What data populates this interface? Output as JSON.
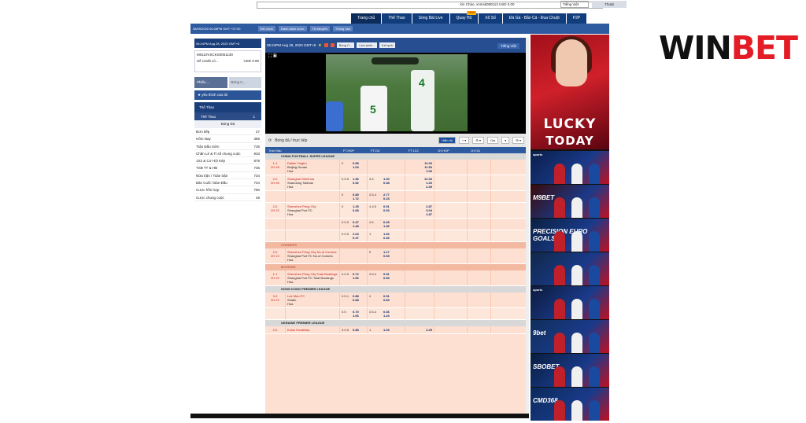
{
  "header": {
    "greeting": "Xin Chào, vnmsk080113 USD 0.00",
    "language": "Tiếng Việt",
    "logout": "Thoát"
  },
  "nav": {
    "tabs": [
      {
        "label": "Trang chủ",
        "badge": ""
      },
      {
        "label": "Thể Thao",
        "badge": ""
      },
      {
        "label": "Sòng Bài Live",
        "badge": ""
      },
      {
        "label": "Quay Hũ",
        "badge": "NEW"
      },
      {
        "label": "Xổ Số",
        "badge": ""
      },
      {
        "label": "Đá Gà - Bắn Cá - Đua Chuột",
        "badge": ""
      },
      {
        "label": "P2P",
        "badge": ""
      }
    ]
  },
  "subnav": {
    "datetime": "08/09/2020 06:28PM GMT +07:00",
    "buttons": [
      "Kết cược",
      "Danh sách cược",
      "Tin khuyến",
      "Thông báo"
    ]
  },
  "video_bar": {
    "datetime": "06:24PM Aug 28, 2020 GMT+8",
    "buttons": [
      "Bóng C...",
      "Lịch phát...",
      "Kết quả"
    ],
    "language": "Tiếng Việt"
  },
  "account": {
    "id": "M0110VSCKS0051130",
    "balance_label": "Số credit có...",
    "balance_value": "USD 0.00"
  },
  "left_buttons": [
    "Phiếu ...",
    "Bóng C..."
  ],
  "favorites": "yêu thích của tôi",
  "sport_header": "Thể Thao",
  "sport_sub": {
    "label": "Thể Thao",
    "count": "1"
  },
  "sport_name": "Bóng Đá",
  "menu": [
    {
      "label": "Đơn tiếp",
      "count": "27"
    },
    {
      "label": "Hôm Nay",
      "count": "385"
    },
    {
      "label": "Trận Đấu Sớm",
      "count": "735"
    },
    {
      "label": "Chấn Lẻ & Tỉ số chung cuộc",
      "count": "933"
    },
    {
      "label": "1X2 & Cơ Hội Kép",
      "count": "878"
    },
    {
      "label": "TSB TT & HB",
      "count": "735"
    },
    {
      "label": "Nửa trận / Toàn trận",
      "count": "734"
    },
    {
      "label": "Bàn Cuối / Bàn Đầu",
      "count": "734"
    },
    {
      "label": "Cược hỗn hợp",
      "count": "780"
    },
    {
      "label": "Cược chung cuộc",
      "count": "49"
    }
  ],
  "content": {
    "title": "Bóng đá / trực tiếp",
    "hot_button": "Hiển thị",
    "odds_button": "Giá",
    "columns": [
      "Trận Đấu",
      "FT.HDP",
      "FT.OU",
      "FT.1X2",
      "1H.HDP",
      "1H.OU"
    ]
  },
  "sections": [
    {
      "type": "league",
      "name": "CHINA FOOTBALL SUPER LEAGUE",
      "rows": [
        {
          "score": "1-1",
          "time": "2H 45",
          "home": "Dalian Yingbo",
          "away": "Beijing Guoan",
          "draw": "Hòa",
          "hdp": "0",
          "hdp_odds": [
            "0.85",
            "1.03"
          ],
          "ou": "",
          "ou_odds": [
            "",
            ""
          ],
          "x12": [
            "11.00",
            "11.50",
            "1.06"
          ]
        },
        {
          "score": "2-0",
          "time": "2H 40",
          "home": "Shanghai Shenhua",
          "away": "Shandong Taishan",
          "draw": "Hòa",
          "hdp": "0-0.5",
          "hdp_odds": [
            "1.36",
            "0.52"
          ],
          "ou": "3.5",
          "ou_odds": [
            "1.40",
            "0.38"
          ],
          "x12": [
            "12.30",
            "1.26",
            "2.39"
          ]
        },
        {
          "score": "",
          "time": "",
          "home": "",
          "away": "",
          "draw": "",
          "hdp": "0",
          "hdp_odds": [
            "0.85",
            "1.72"
          ],
          "ou": "3.5-4",
          "ou_odds": [
            "2.77",
            "0.23"
          ],
          "x12": [
            "",
            "",
            ""
          ]
        },
        {
          "score": "2-0",
          "time": "2H 22",
          "home": "Shenzhen Peng City",
          "away": "Shanghai Port FC",
          "draw": "Hòa",
          "hdp": "0",
          "hdp_odds": [
            "1.25",
            "0.68"
          ],
          "ou": "4-4.5",
          "ou_odds": [
            "0.91",
            "0.93"
          ],
          "x12": [
            "2.87",
            "3.04",
            "1.87"
          ]
        },
        {
          "score": "",
          "time": "",
          "home": "",
          "away": "",
          "draw": "",
          "hdp": "0-0.5",
          "hdp_odds": [
            "0.37",
            "1.48"
          ],
          "ou": "4.5",
          "ou_odds": [
            "0.39",
            "1.36"
          ],
          "x12": [
            "",
            "",
            ""
          ]
        },
        {
          "score": "",
          "time": "",
          "home": "",
          "away": "",
          "draw": "",
          "hdp": "0-0.5",
          "hdp_odds": [
            "2.04",
            "0.37"
          ],
          "ou": "1",
          "ou_odds": [
            "1.66",
            "0.46"
          ],
          "x12": [
            "",
            "",
            ""
          ]
        }
      ]
    },
    {
      "type": "category",
      "name": "CORNERS",
      "rows": [
        {
          "score": "2-0",
          "time": "2H 22",
          "home": "Shenzhen Peng City No.of Corners",
          "away": "Shanghai Port FC No.of Corners",
          "draw": "Hòa",
          "hdp": "",
          "hdp_odds": [
            "",
            ""
          ],
          "ou": "5",
          "ou_odds": [
            "1.17",
            "0.65"
          ],
          "x12": [
            "",
            "",
            ""
          ]
        }
      ]
    },
    {
      "type": "category",
      "name": "BOOKING",
      "rows": [
        {
          "score": "1-1",
          "time": "2H 22",
          "home": "Shenzhen Peng City Total Bookings",
          "away": "Shanghai Port FC Total Bookings",
          "draw": "Hòa",
          "hdp": "0-0.5",
          "hdp_odds": [
            "0.72",
            "1.06"
          ],
          "ou": "3.5-4",
          "ou_odds": [
            "0.91",
            "0.83"
          ],
          "x12": [
            "",
            "",
            ""
          ]
        }
      ]
    },
    {
      "type": "league",
      "name": "HONG KONG PREMIER LEAGUE",
      "rows": [
        {
          "score": "3-0",
          "time": "2H 22",
          "home": "Lee Man FC",
          "away": "Shatin",
          "draw": "Hòa",
          "hdp": "0.5-1",
          "hdp_odds": [
            "0.88",
            "0.88"
          ],
          "ou": "4",
          "ou_odds": [
            "0.91",
            "0.83"
          ],
          "x12": [
            "",
            "",
            ""
          ]
        },
        {
          "score": "",
          "time": "",
          "home": "",
          "away": "",
          "draw": "",
          "hdp": "0.5",
          "hdp_odds": [
            "0.70",
            "1.06"
          ],
          "ou": "3.5-4",
          "ou_odds": [
            "0.36",
            "1.23"
          ],
          "x12": [
            "",
            "",
            ""
          ]
        }
      ]
    },
    {
      "type": "league",
      "name": "UKRAINE PREMIER LEAGUE",
      "rows": [
        {
          "score": "2-0",
          "time": "",
          "home": "Kolos Kovalivka",
          "away": "",
          "draw": "",
          "hdp": "0-0.5",
          "hdp_odds": [
            "0.85",
            ""
          ],
          "ou": "1",
          "ou_odds": [
            "1.03",
            ""
          ],
          "x12": [
            "2.25",
            "",
            ""
          ]
        }
      ]
    }
  ],
  "banner": {
    "main_line1": "LUCKY",
    "main_line2": "TODAY",
    "ads": [
      {
        "label": "sports",
        "big": ""
      },
      {
        "label": "",
        "big": "M9BET"
      },
      {
        "label": "",
        "big": "PRECISION EURO GOALS"
      },
      {
        "label": "",
        "big": ""
      },
      {
        "label": "sports",
        "big": ""
      },
      {
        "label": "",
        "big": "9bet"
      },
      {
        "label": "",
        "big": "SBOBET"
      },
      {
        "label": "",
        "big": "CMD368"
      }
    ]
  },
  "logo": {
    "part1": "WIN",
    "part2": "BET"
  },
  "colors": {
    "nav": "#123d7c",
    "accent": "#e31c25",
    "table_bg": "#fde0d2"
  }
}
